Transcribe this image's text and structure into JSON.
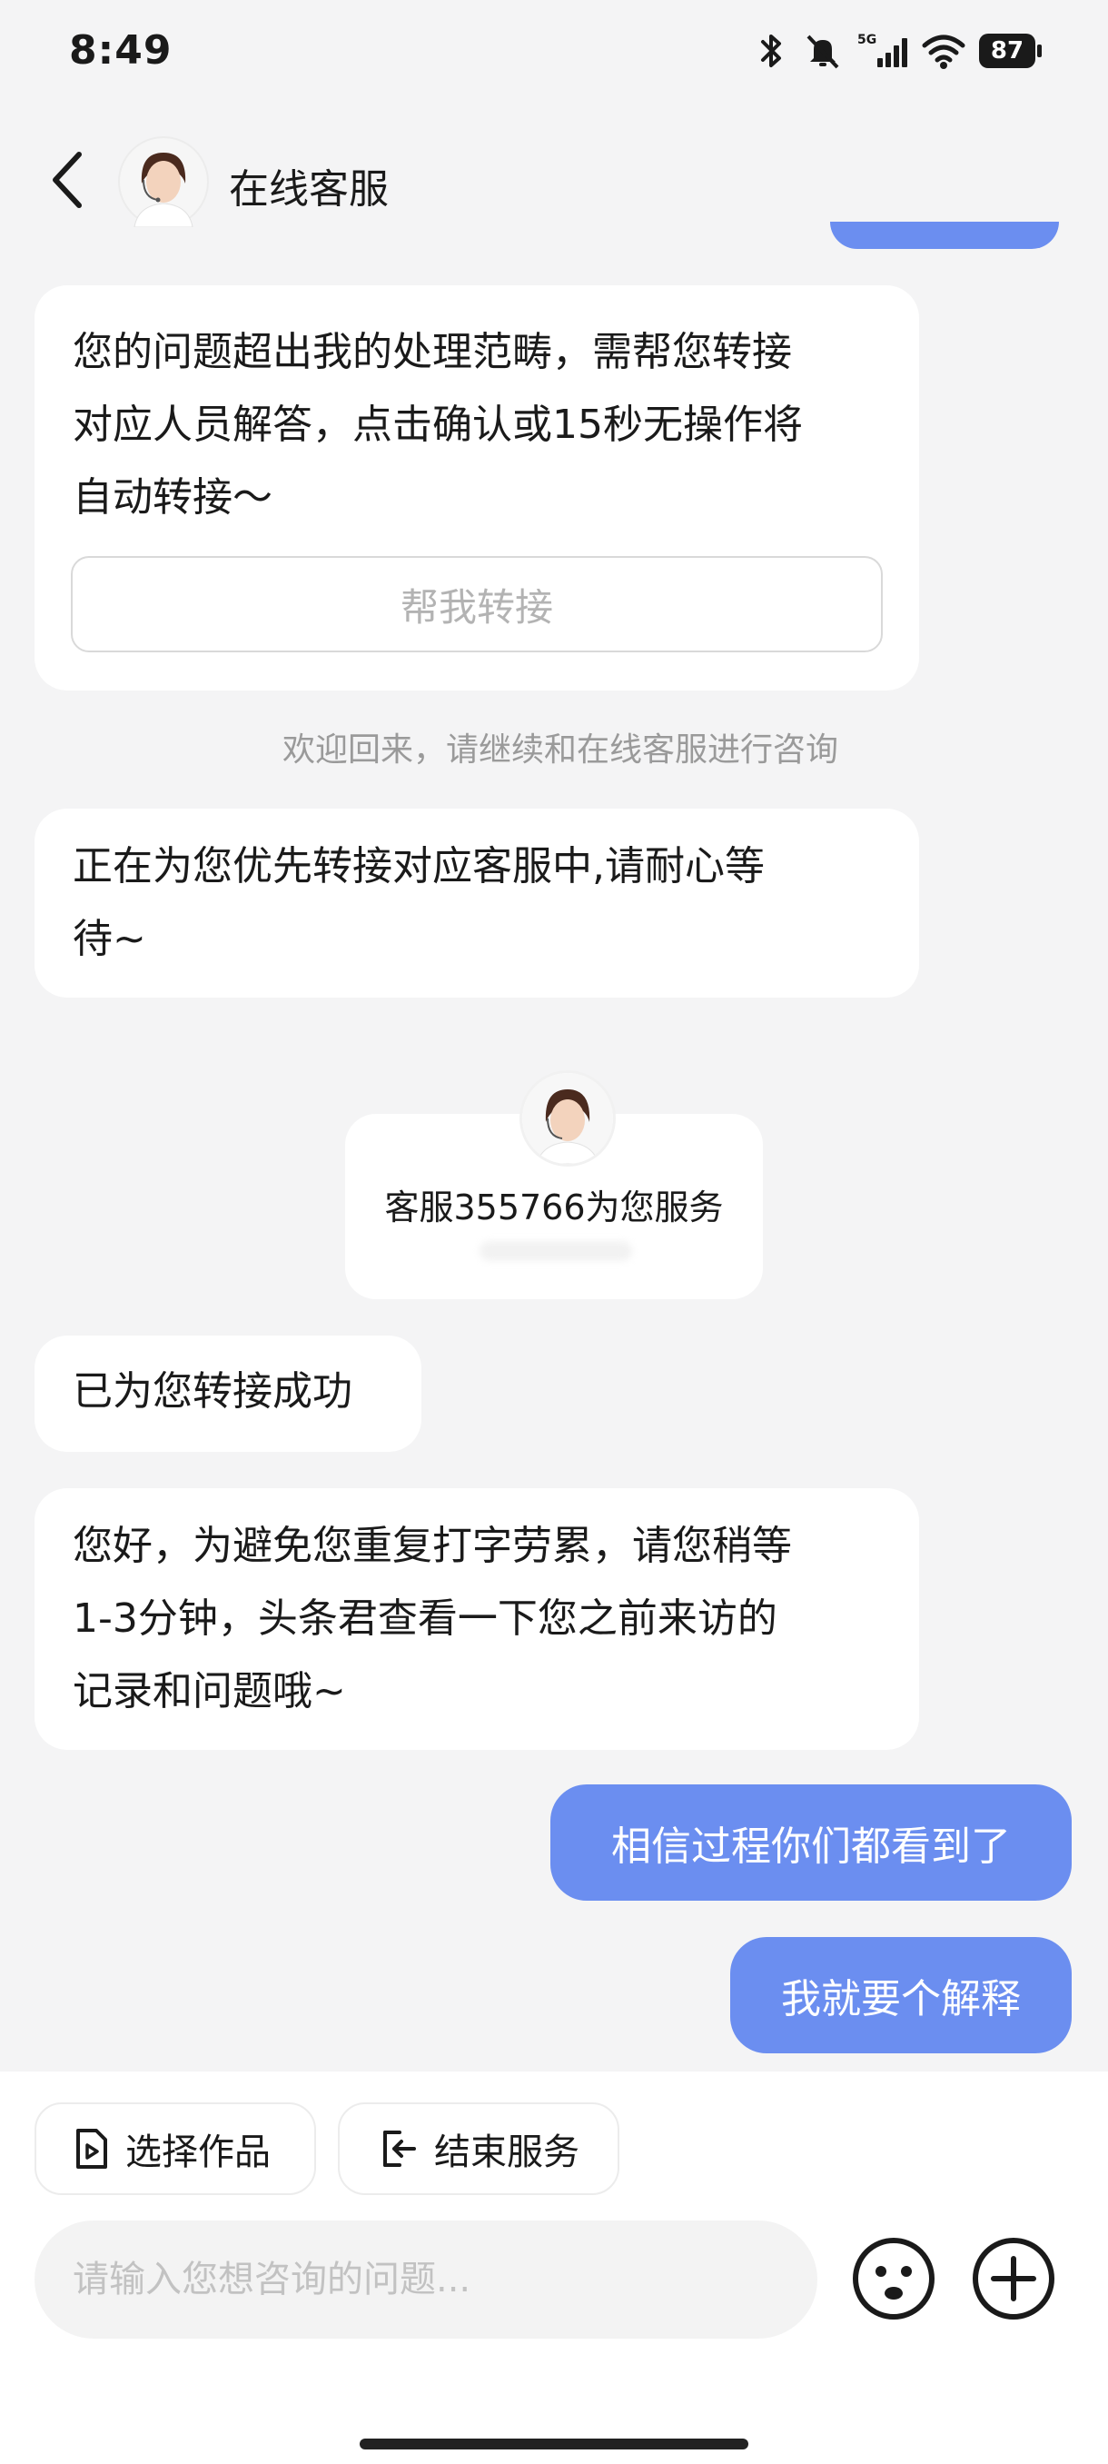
{
  "status_bar": {
    "time": "8:49",
    "battery": "87",
    "network": "5G",
    "icons": [
      "bluetooth-icon",
      "mute-icon",
      "signal-icon",
      "wifi-icon",
      "battery-icon"
    ]
  },
  "header": {
    "title": "在线客服",
    "back_icon": "chevron-left-icon"
  },
  "messages": {
    "m1": {
      "text": "您的问题超出我的处理范畴，需帮您转接\n对应人员解答，点击确认或15秒无操作将\n自动转接～",
      "button_label": "帮我转接"
    },
    "system_note": "欢迎回来，请继续和在线客服进行咨询",
    "m2": {
      "text": "正在为您优先转接对应客服中,请耐心等\n待~"
    },
    "agent_card": {
      "text": "客服355766为您服务"
    },
    "m3": {
      "text": "已为您转接成功"
    },
    "m4": {
      "text": "您好，为避免您重复打字劳累，请您稍等\n1-3分钟，头条君查看一下您之前来访的\n记录和问题哦~"
    },
    "o1": {
      "text": "相信过程你们都看到了"
    },
    "o2": {
      "text": "我就要个解释"
    }
  },
  "bottom": {
    "quick_actions": [
      {
        "label": "选择作品",
        "icon": "video-file-icon"
      },
      {
        "label": "结束服务",
        "icon": "exit-icon"
      }
    ],
    "input": {
      "placeholder": "请输入您想咨询的问题...",
      "value": ""
    },
    "emoji_icon": "emoji-icon",
    "plus_icon": "plus-icon"
  },
  "colors": {
    "outgoing_bubble": "#6b8ef0",
    "background": "#f4f4f5",
    "incoming_bubble": "#ffffff"
  }
}
